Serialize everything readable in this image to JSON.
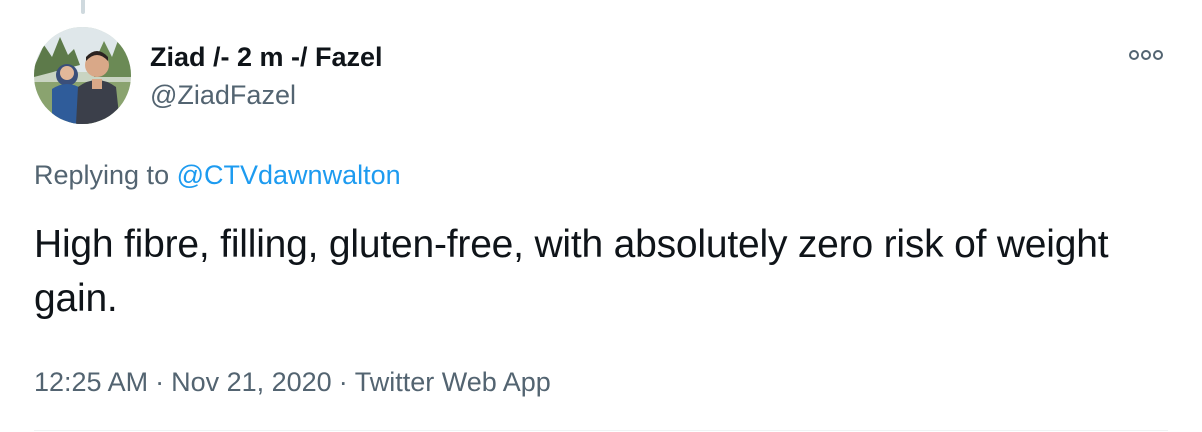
{
  "tweet": {
    "author": {
      "display_name": "Ziad /- 2 m -/ Fazel",
      "handle": "@ZiadFazel"
    },
    "replying_prefix": "Replying to",
    "replying_to": "@CTVdawnwalton",
    "text": "High fibre, filling, gluten-free, with absolutely zero risk of weight gain.",
    "time": "12:25 AM",
    "date": "Nov 21, 2020",
    "source": "Twitter Web App",
    "separator": "·"
  },
  "icons": {
    "more": "more-options-icon",
    "avatar": "avatar-photo"
  },
  "colors": {
    "accent": "#1d9bf0",
    "text_primary": "#0f1419",
    "text_secondary": "#536471",
    "thread_line": "#cfd9de"
  }
}
